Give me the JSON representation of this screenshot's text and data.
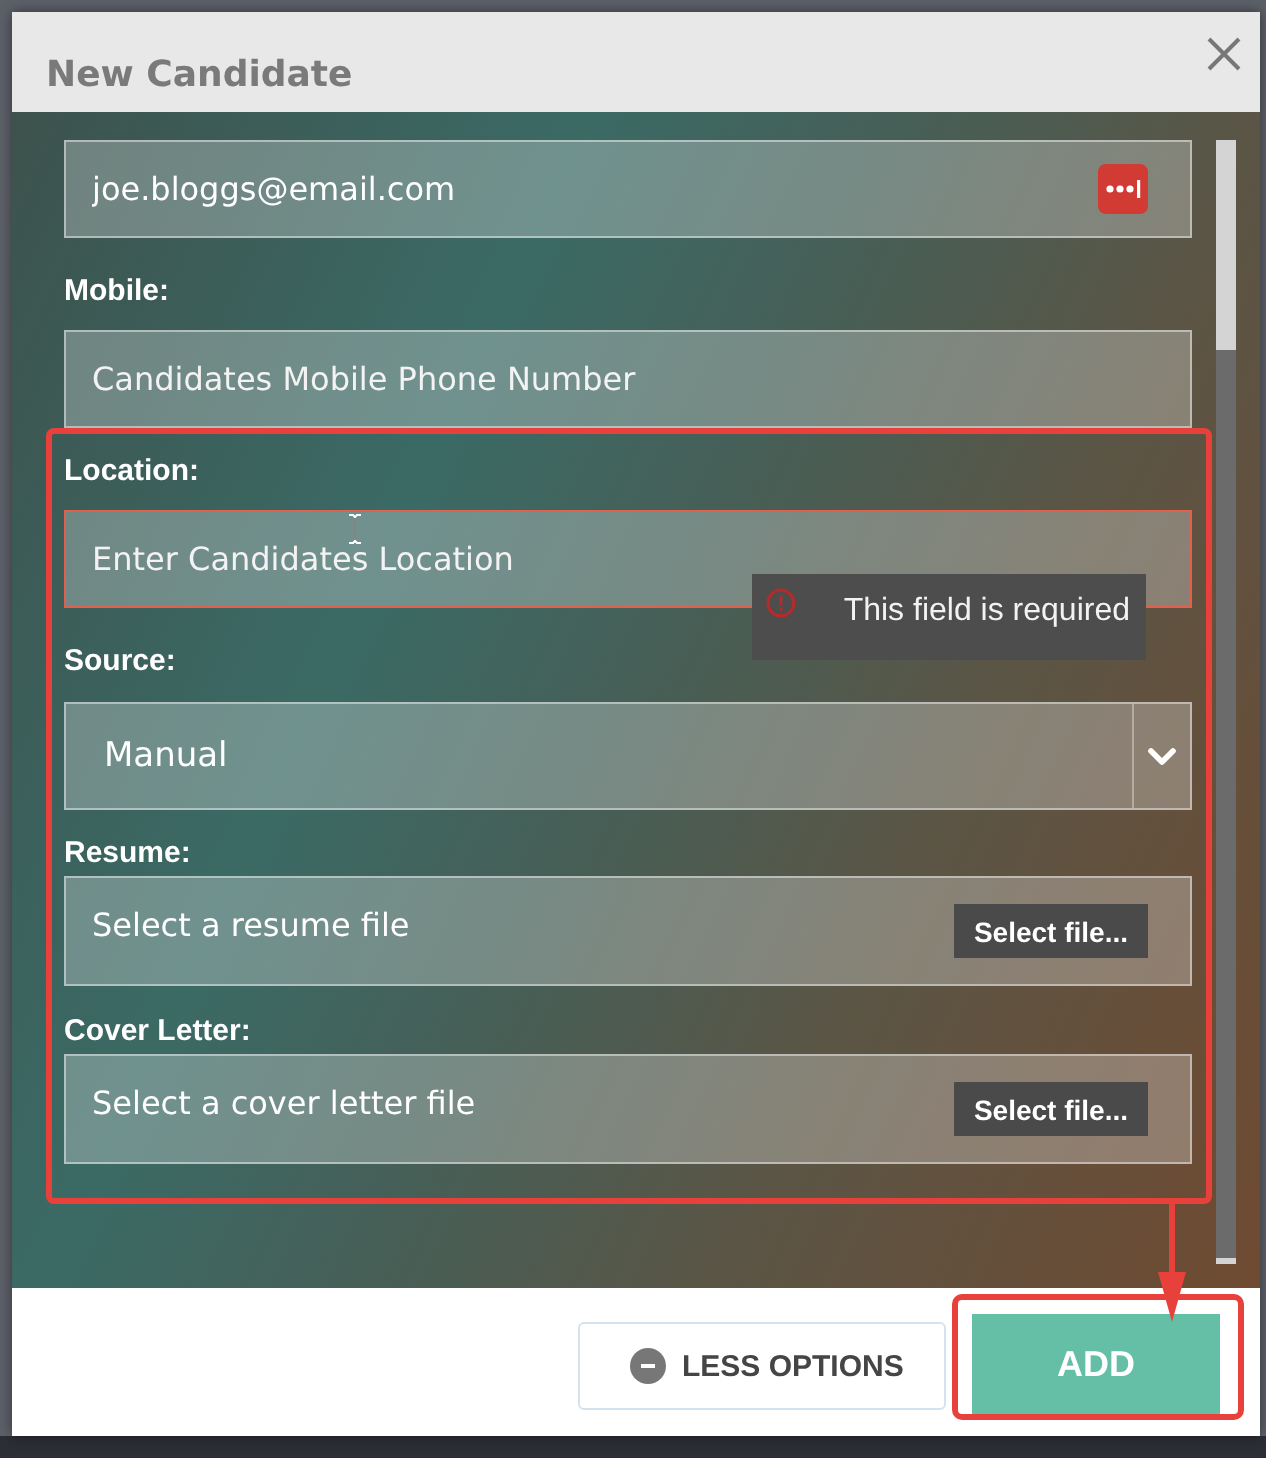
{
  "dialog": {
    "title": "New Candidate"
  },
  "fields": [
    {
      "kind": "text",
      "value": "joe.bloggs@email.com",
      "password_icon": true,
      "invalid": false,
      "hovered": false,
      "highlighted": false
    },
    {
      "kind": "text",
      "label": "Mobile:",
      "placeholder": "Candidates Mobile Phone Number",
      "invalid": false,
      "hovered": false,
      "highlighted": false
    },
    {
      "kind": "text",
      "label": "Location:",
      "placeholder": "Enter Candidates Location",
      "invalid": true,
      "hovered": true,
      "error": "This field is required",
      "highlighted": true
    },
    {
      "kind": "select",
      "label": "Source:",
      "value": "Manual",
      "highlighted": true
    },
    {
      "kind": "file",
      "label": "Resume:",
      "placeholder": "Select a resume file",
      "button": "Select file...",
      "highlighted": true
    },
    {
      "kind": "file",
      "label": "Cover Letter:",
      "placeholder": "Select a cover letter file",
      "button": "Select file...",
      "highlighted": true
    }
  ],
  "buttons": [
    {
      "kind": "secondary",
      "label": "LESS OPTIONS",
      "highlighted": false
    },
    {
      "kind": "primary",
      "label": "ADD",
      "highlighted": true
    }
  ]
}
